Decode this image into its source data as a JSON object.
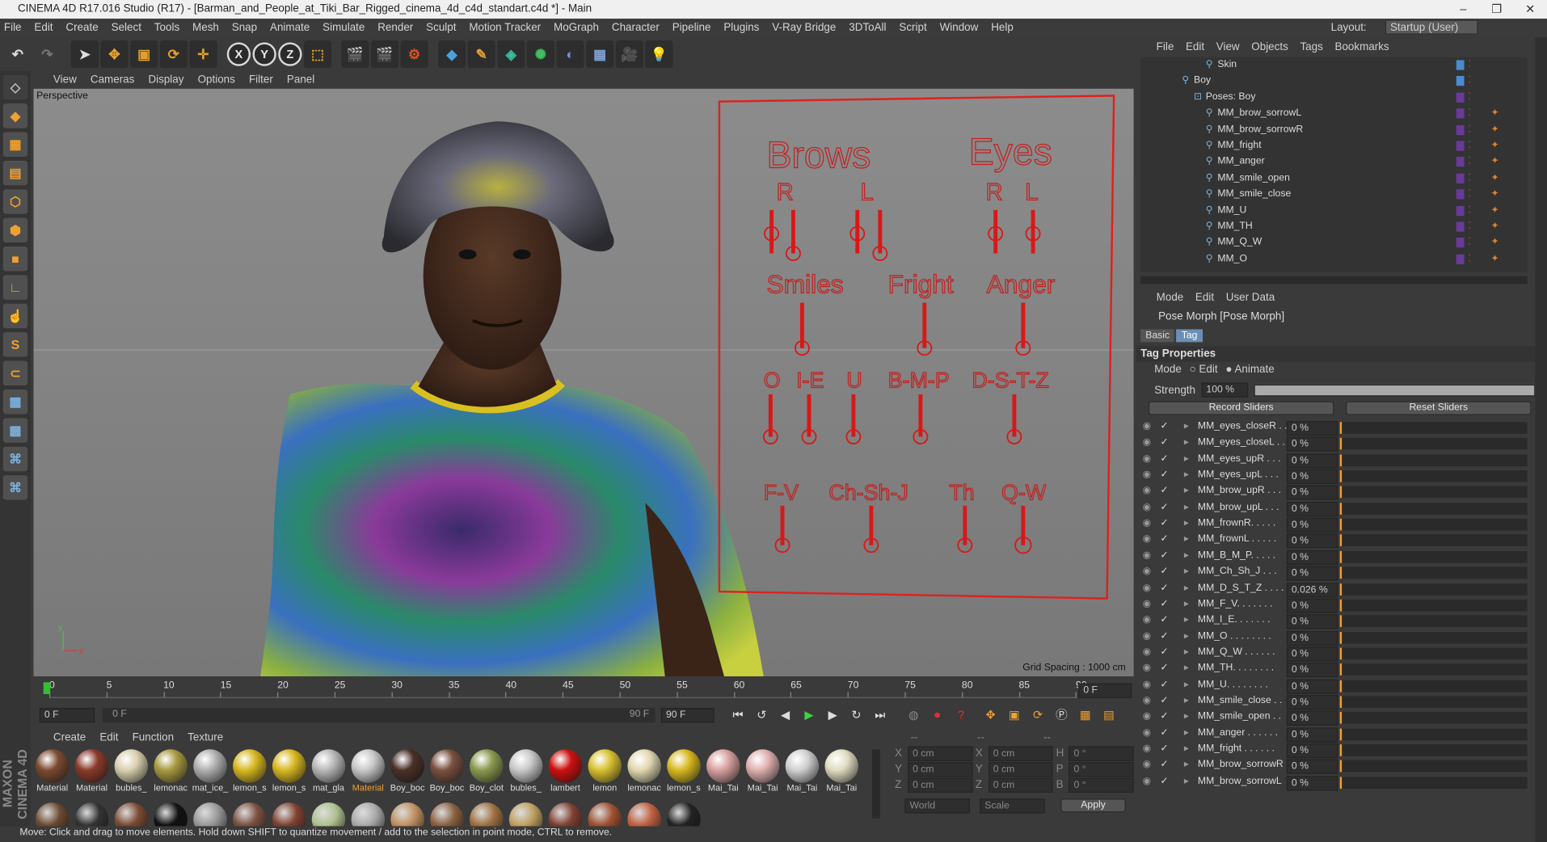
{
  "window": {
    "title": "CINEMA 4D R17.016 Studio (R17) - [Barman_and_People_at_Tiki_Bar_Rigged_cinema_4d_c4d_standart.c4d *] - Main"
  },
  "menubar": {
    "items": [
      "File",
      "Edit",
      "Create",
      "Select",
      "Tools",
      "Mesh",
      "Snap",
      "Animate",
      "Simulate",
      "Render",
      "Sculpt",
      "Motion Tracker",
      "MoGraph",
      "Character",
      "Pipeline",
      "Plugins",
      "V-Ray Bridge",
      "3DToAll",
      "Script",
      "Window",
      "Help"
    ],
    "layout_label": "Layout:",
    "layout_value": "Startup (User)"
  },
  "toolbar": {
    "axis_x": "X",
    "axis_y": "Y",
    "axis_z": "Z"
  },
  "viewport": {
    "menu": [
      "View",
      "Cameras",
      "Display",
      "Options",
      "Filter",
      "Panel"
    ],
    "camera_label": "Perspective",
    "grid_spacing": "Grid Spacing : 1000 cm"
  },
  "rig_panel": {
    "brows": "Brows",
    "eyes": "Eyes",
    "R": "R",
    "L": "L",
    "smiles": "Smiles",
    "fright": "Fright",
    "anger": "Anger",
    "O": "O",
    "IE": "I-E",
    "U": "U",
    "BMP": "B-M-P",
    "DSTZ": "D-S-T-Z",
    "FV": "F-V",
    "ChShJ": "Ch-Sh-J",
    "Th": "Th",
    "QW": "Q-W"
  },
  "timeline": {
    "ticks": [
      "0",
      "5",
      "10",
      "15",
      "20",
      "25",
      "30",
      "35",
      "40",
      "45",
      "50",
      "55",
      "60",
      "65",
      "70",
      "75",
      "80",
      "85",
      "90"
    ],
    "current_frame": "0 F"
  },
  "playbar": {
    "start": "0 F",
    "range_start": "0 F",
    "range_end": "90 F",
    "end": "90 F"
  },
  "materials": {
    "menu": [
      "Create",
      "Edit",
      "Function",
      "Texture"
    ],
    "row1": [
      {
        "name": "Material",
        "color": "#7a4a30"
      },
      {
        "name": "Material",
        "color": "#8a3a2a"
      },
      {
        "name": "bubles_",
        "color": "#d8d0b0"
      },
      {
        "name": "lemonac",
        "color": "#a89a40"
      },
      {
        "name": "mat_ice_",
        "color": "#b0b0b0"
      },
      {
        "name": "lemon_s",
        "color": "#d8b820"
      },
      {
        "name": "lemon_s",
        "color": "#d8b820"
      },
      {
        "name": "mat_gla",
        "color": "#b8b8b8"
      },
      {
        "name": "Material",
        "color": "#c8c8c8"
      },
      {
        "name": "Boy_boc",
        "color": "#4a3028"
      },
      {
        "name": "Boy_boc",
        "color": "#7a5040"
      },
      {
        "name": "Boy_clot",
        "color": "#8a9a50"
      },
      {
        "name": "bubles_",
        "color": "#c8c8c8"
      },
      {
        "name": "lambert",
        "color": "#cc1010"
      },
      {
        "name": "lemon",
        "color": "#d8c030"
      },
      {
        "name": "lemonac",
        "color": "#e0d8b0"
      },
      {
        "name": "lemon_s",
        "color": "#d8b820"
      },
      {
        "name": "Mai_Tai",
        "color": "#d8a0a0"
      },
      {
        "name": "Mai_Tai",
        "color": "#e0b0b0"
      },
      {
        "name": "Mai_Tai",
        "color": "#d0d0d0"
      },
      {
        "name": "Mai_Tai",
        "color": "#e0dcc0"
      }
    ]
  },
  "coords": {
    "dash": "--",
    "x": "X",
    "y": "Y",
    "z": "Z",
    "h": "H",
    "p": "P",
    "b": "B",
    "pos_x": "0 cm",
    "pos_y": "0 cm",
    "pos_z": "0 cm",
    "size_x": "0 cm",
    "size_y": "0 cm",
    "size_z": "0 cm",
    "rot_h": "0 °",
    "rot_p": "0 °",
    "rot_b": "0 °",
    "world": "World",
    "scale": "Scale",
    "apply": "Apply"
  },
  "status": "Move: Click and drag to move elements. Hold down SHIFT to quantize movement / add to the selection in point mode, CTRL to remove.",
  "objects": {
    "menu": [
      "File",
      "Edit",
      "View",
      "Objects",
      "Tags",
      "Bookmarks"
    ],
    "rows": [
      {
        "name": "Skin",
        "indent": 3
      },
      {
        "name": "Boy",
        "indent": 1
      },
      {
        "name": "Poses: Boy",
        "indent": 2
      },
      {
        "name": "MM_brow_sorrowL",
        "indent": 3
      },
      {
        "name": "MM_brow_sorrowR",
        "indent": 3
      },
      {
        "name": "MM_fright",
        "indent": 3
      },
      {
        "name": "MM_anger",
        "indent": 3
      },
      {
        "name": "MM_smile_open",
        "indent": 3
      },
      {
        "name": "MM_smile_close",
        "indent": 3
      },
      {
        "name": "MM_U",
        "indent": 3
      },
      {
        "name": "MM_TH",
        "indent": 3
      },
      {
        "name": "MM_Q_W",
        "indent": 3
      },
      {
        "name": "MM_O",
        "indent": 3
      }
    ]
  },
  "attributes": {
    "menu": [
      "Mode",
      "Edit",
      "User Data"
    ],
    "title": "Pose Morph [Pose Morph]",
    "tabs": [
      "Basic",
      "Tag"
    ],
    "section": "Tag Properties",
    "mode_label": "Mode",
    "mode_edit": "Edit",
    "mode_animate": "Animate",
    "strength_label": "Strength",
    "strength_value": "100 %",
    "record": "Record Sliders",
    "reset": "Reset Sliders",
    "sliders": [
      {
        "name": "MM_eyes_closeR . .",
        "value": "0 %"
      },
      {
        "name": "MM_eyes_closeL . .",
        "value": "0 %"
      },
      {
        "name": "MM_eyes_upR . . .",
        "value": "0 %"
      },
      {
        "name": "MM_eyes_upL . . .",
        "value": "0 %"
      },
      {
        "name": "MM_brow_upR . . .",
        "value": "0 %"
      },
      {
        "name": "MM_brow_upL . . .",
        "value": "0 %"
      },
      {
        "name": "MM_frownR. . . . .",
        "value": "0 %"
      },
      {
        "name": "MM_frownL . . . . .",
        "value": "0 %"
      },
      {
        "name": "MM_B_M_P. . . . .",
        "value": "0 %"
      },
      {
        "name": "MM_Ch_Sh_J . . .",
        "value": "0 %"
      },
      {
        "name": "MM_D_S_T_Z . . . .",
        "value": "0.026 %"
      },
      {
        "name": "MM_F_V. . . . . . .",
        "value": "0 %"
      },
      {
        "name": "MM_I_E. . . . . . .",
        "value": "0 %"
      },
      {
        "name": "MM_O . . . . . . . .",
        "value": "0 %"
      },
      {
        "name": "MM_Q_W . . . . . .",
        "value": "0 %"
      },
      {
        "name": "MM_TH. . . . . . . .",
        "value": "0 %"
      },
      {
        "name": "MM_U. . . . . . . .",
        "value": "0 %"
      },
      {
        "name": "MM_smile_close . .",
        "value": "0 %"
      },
      {
        "name": "MM_smile_open . .",
        "value": "0 %"
      },
      {
        "name": "MM_anger . . . . . .",
        "value": "0 %"
      },
      {
        "name": "MM_fright . . . . . .",
        "value": "0 %"
      },
      {
        "name": "MM_brow_sorrowR",
        "value": "0 %"
      },
      {
        "name": "MM_brow_sorrowL",
        "value": "0 %"
      }
    ]
  }
}
